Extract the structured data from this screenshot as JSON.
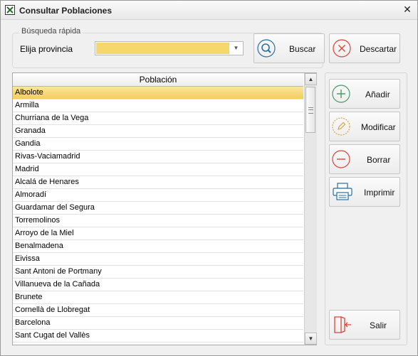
{
  "window": {
    "title": "Consultar Poblaciones",
    "close_glyph": "✕"
  },
  "search": {
    "group_label": "Búsqueda rápida",
    "province_label": "Elija provincia",
    "province_value": "",
    "buscar_label": "Buscar",
    "descartar_label": "Descartar"
  },
  "grid": {
    "column_header": "Población",
    "rows": [
      "Albolote",
      "Armilla",
      "Churriana de la Vega",
      "Granada",
      "Gandia",
      "Rivas-Vaciamadrid",
      "Madrid",
      "Alcalá de Henares",
      "Almoradí",
      "Guardamar del Segura",
      "Torremolinos",
      "Arroyo de la Miel",
      "Benalmadena",
      "Eivissa",
      "Sant Antoni de Portmany",
      "Villanueva de la Cañada",
      "Brunete",
      "Cornellà de Llobregat",
      "Barcelona",
      "Sant Cugat del Vallès"
    ],
    "selected_index": 0,
    "selected_color": "#f3cd5c"
  },
  "actions": {
    "anadir_label": "Añadir",
    "modificar_label": "Modificar",
    "borrar_label": "Borrar",
    "imprimir_label": "Imprimir",
    "salir_label": "Salir"
  },
  "icons": {
    "buscar": "magnifier-icon",
    "descartar": "x-circle-icon",
    "anadir": "plus-circle-icon",
    "modificar": "pencil-circle-icon",
    "borrar": "minus-circle-icon",
    "imprimir": "printer-icon",
    "salir": "exit-door-icon"
  },
  "colors": {
    "accent_green": "#4a9a6a",
    "accent_red": "#d9453a",
    "accent_blue": "#2a6e9e",
    "accent_orange": "#d9a44a",
    "combo_fill": "#f5d76e"
  }
}
